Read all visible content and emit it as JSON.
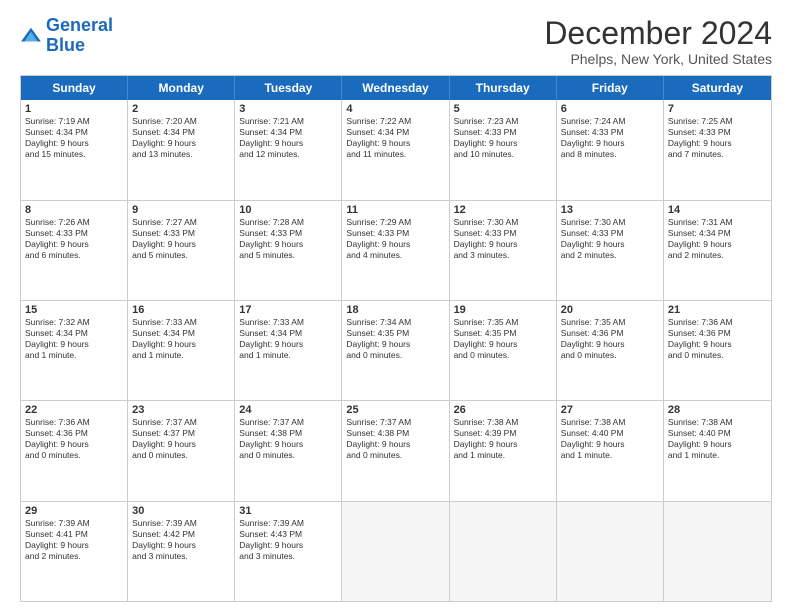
{
  "logo": {
    "line1": "General",
    "line2": "Blue"
  },
  "title": "December 2024",
  "subtitle": "Phelps, New York, United States",
  "header_days": [
    "Sunday",
    "Monday",
    "Tuesday",
    "Wednesday",
    "Thursday",
    "Friday",
    "Saturday"
  ],
  "rows": [
    [
      {
        "day": "1",
        "info": "Sunrise: 7:19 AM\nSunset: 4:34 PM\nDaylight: 9 hours\nand 15 minutes."
      },
      {
        "day": "2",
        "info": "Sunrise: 7:20 AM\nSunset: 4:34 PM\nDaylight: 9 hours\nand 13 minutes."
      },
      {
        "day": "3",
        "info": "Sunrise: 7:21 AM\nSunset: 4:34 PM\nDaylight: 9 hours\nand 12 minutes."
      },
      {
        "day": "4",
        "info": "Sunrise: 7:22 AM\nSunset: 4:34 PM\nDaylight: 9 hours\nand 11 minutes."
      },
      {
        "day": "5",
        "info": "Sunrise: 7:23 AM\nSunset: 4:33 PM\nDaylight: 9 hours\nand 10 minutes."
      },
      {
        "day": "6",
        "info": "Sunrise: 7:24 AM\nSunset: 4:33 PM\nDaylight: 9 hours\nand 8 minutes."
      },
      {
        "day": "7",
        "info": "Sunrise: 7:25 AM\nSunset: 4:33 PM\nDaylight: 9 hours\nand 7 minutes."
      }
    ],
    [
      {
        "day": "8",
        "info": "Sunrise: 7:26 AM\nSunset: 4:33 PM\nDaylight: 9 hours\nand 6 minutes."
      },
      {
        "day": "9",
        "info": "Sunrise: 7:27 AM\nSunset: 4:33 PM\nDaylight: 9 hours\nand 5 minutes."
      },
      {
        "day": "10",
        "info": "Sunrise: 7:28 AM\nSunset: 4:33 PM\nDaylight: 9 hours\nand 5 minutes."
      },
      {
        "day": "11",
        "info": "Sunrise: 7:29 AM\nSunset: 4:33 PM\nDaylight: 9 hours\nand 4 minutes."
      },
      {
        "day": "12",
        "info": "Sunrise: 7:30 AM\nSunset: 4:33 PM\nDaylight: 9 hours\nand 3 minutes."
      },
      {
        "day": "13",
        "info": "Sunrise: 7:30 AM\nSunset: 4:33 PM\nDaylight: 9 hours\nand 2 minutes."
      },
      {
        "day": "14",
        "info": "Sunrise: 7:31 AM\nSunset: 4:34 PM\nDaylight: 9 hours\nand 2 minutes."
      }
    ],
    [
      {
        "day": "15",
        "info": "Sunrise: 7:32 AM\nSunset: 4:34 PM\nDaylight: 9 hours\nand 1 minute."
      },
      {
        "day": "16",
        "info": "Sunrise: 7:33 AM\nSunset: 4:34 PM\nDaylight: 9 hours\nand 1 minute."
      },
      {
        "day": "17",
        "info": "Sunrise: 7:33 AM\nSunset: 4:34 PM\nDaylight: 9 hours\nand 1 minute."
      },
      {
        "day": "18",
        "info": "Sunrise: 7:34 AM\nSunset: 4:35 PM\nDaylight: 9 hours\nand 0 minutes."
      },
      {
        "day": "19",
        "info": "Sunrise: 7:35 AM\nSunset: 4:35 PM\nDaylight: 9 hours\nand 0 minutes."
      },
      {
        "day": "20",
        "info": "Sunrise: 7:35 AM\nSunset: 4:36 PM\nDaylight: 9 hours\nand 0 minutes."
      },
      {
        "day": "21",
        "info": "Sunrise: 7:36 AM\nSunset: 4:36 PM\nDaylight: 9 hours\nand 0 minutes."
      }
    ],
    [
      {
        "day": "22",
        "info": "Sunrise: 7:36 AM\nSunset: 4:36 PM\nDaylight: 9 hours\nand 0 minutes."
      },
      {
        "day": "23",
        "info": "Sunrise: 7:37 AM\nSunset: 4:37 PM\nDaylight: 9 hours\nand 0 minutes."
      },
      {
        "day": "24",
        "info": "Sunrise: 7:37 AM\nSunset: 4:38 PM\nDaylight: 9 hours\nand 0 minutes."
      },
      {
        "day": "25",
        "info": "Sunrise: 7:37 AM\nSunset: 4:38 PM\nDaylight: 9 hours\nand 0 minutes."
      },
      {
        "day": "26",
        "info": "Sunrise: 7:38 AM\nSunset: 4:39 PM\nDaylight: 9 hours\nand 1 minute."
      },
      {
        "day": "27",
        "info": "Sunrise: 7:38 AM\nSunset: 4:40 PM\nDaylight: 9 hours\nand 1 minute."
      },
      {
        "day": "28",
        "info": "Sunrise: 7:38 AM\nSunset: 4:40 PM\nDaylight: 9 hours\nand 1 minute."
      }
    ],
    [
      {
        "day": "29",
        "info": "Sunrise: 7:39 AM\nSunset: 4:41 PM\nDaylight: 9 hours\nand 2 minutes."
      },
      {
        "day": "30",
        "info": "Sunrise: 7:39 AM\nSunset: 4:42 PM\nDaylight: 9 hours\nand 3 minutes."
      },
      {
        "day": "31",
        "info": "Sunrise: 7:39 AM\nSunset: 4:43 PM\nDaylight: 9 hours\nand 3 minutes."
      },
      {
        "day": "",
        "info": ""
      },
      {
        "day": "",
        "info": ""
      },
      {
        "day": "",
        "info": ""
      },
      {
        "day": "",
        "info": ""
      }
    ]
  ]
}
